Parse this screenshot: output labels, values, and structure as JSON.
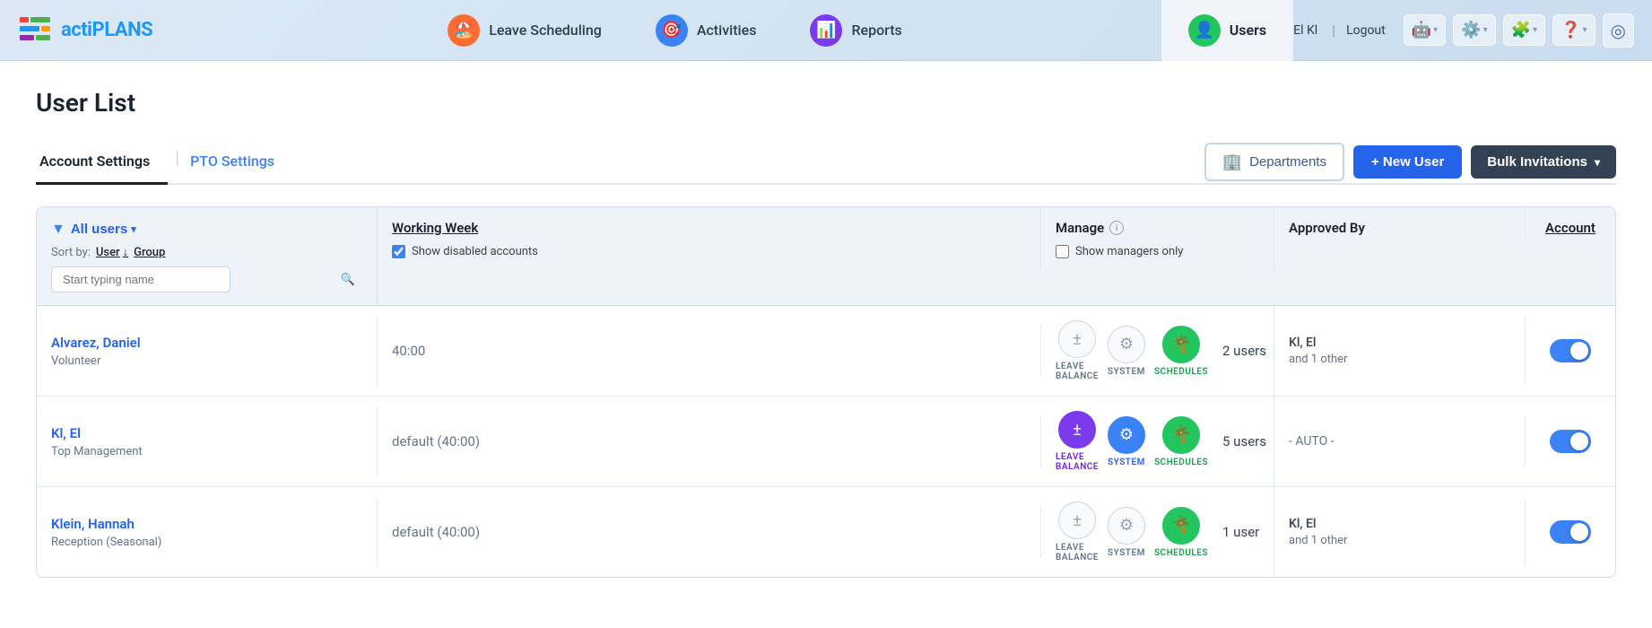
{
  "app": {
    "logo": "actiPLANS",
    "logo_prefix": "acti",
    "logo_suffix": "PLANS"
  },
  "topnav": {
    "user_initials": "El Kl",
    "logout_label": "Logout",
    "nav_items": [
      {
        "id": "leave-scheduling",
        "label": "Leave Scheduling",
        "icon": "🏖️",
        "icon_bg": "orange"
      },
      {
        "id": "activities",
        "label": "Activities",
        "icon": "🎯",
        "icon_bg": "blue"
      },
      {
        "id": "reports",
        "label": "Reports",
        "icon": "📊",
        "icon_bg": "purple"
      },
      {
        "id": "users",
        "label": "Users",
        "icon": "👤",
        "icon_bg": "green",
        "active": true
      }
    ],
    "icon_buttons": [
      {
        "id": "bot",
        "icon": "🤖",
        "has_chevron": true
      },
      {
        "id": "settings",
        "icon": "⚙️",
        "has_chevron": true
      },
      {
        "id": "extensions",
        "icon": "🧩",
        "has_chevron": true
      },
      {
        "id": "help",
        "icon": "❓",
        "has_chevron": true
      },
      {
        "id": "profile-circle",
        "icon": "⊙",
        "has_chevron": false
      }
    ]
  },
  "page": {
    "title": "User List",
    "tabs": [
      {
        "id": "account-settings",
        "label": "Account Settings",
        "active": true
      },
      {
        "id": "pto-settings",
        "label": "PTO Settings",
        "active": false
      }
    ],
    "buttons": {
      "departments": "Departments",
      "new_user": "+ New User",
      "bulk_invitations": "Bulk Invitations"
    }
  },
  "filters": {
    "all_users_label": "All users",
    "sort_by_label": "Sort by:",
    "user_label": "User",
    "group_label": "Group",
    "search_placeholder": "Start typing name",
    "show_disabled_label": "Show disabled accounts",
    "show_managers_label": "Show managers only",
    "columns": {
      "working_week": "Working Week",
      "manage": "Manage",
      "approved_by": "Approved By",
      "account": "Account"
    }
  },
  "users": [
    {
      "id": "alvarez-daniel",
      "name": "Alvarez, Daniel",
      "role": "Volunteer",
      "working_week": "40:00",
      "working_week_default": false,
      "manage": {
        "leave_balance": {
          "active": false
        },
        "system": {
          "active": false
        },
        "schedules": {
          "active": true,
          "color": "green"
        },
        "count": "2 users"
      },
      "approved_by": {
        "names": "Kl, El",
        "other": "and 1 other"
      },
      "account_enabled": true
    },
    {
      "id": "kl-el",
      "name": "Kl, El",
      "role": "Top Management",
      "working_week": "default (40:00)",
      "working_week_default": true,
      "manage": {
        "leave_balance": {
          "active": true,
          "color": "purple"
        },
        "system": {
          "active": true,
          "color": "blue"
        },
        "schedules": {
          "active": true,
          "color": "green"
        },
        "count": "5 users"
      },
      "approved_by": {
        "names": "- AUTO -",
        "other": null
      },
      "account_enabled": true
    },
    {
      "id": "klein-hannah",
      "name": "Klein, Hannah",
      "role": "Reception (Seasonal)",
      "working_week": "default (40:00)",
      "working_week_default": true,
      "manage": {
        "leave_balance": {
          "active": false
        },
        "system": {
          "active": false
        },
        "schedules": {
          "active": true,
          "color": "green"
        },
        "count": "1 user"
      },
      "approved_by": {
        "names": "Kl, El",
        "other": "and 1 other"
      },
      "account_enabled": true
    }
  ]
}
